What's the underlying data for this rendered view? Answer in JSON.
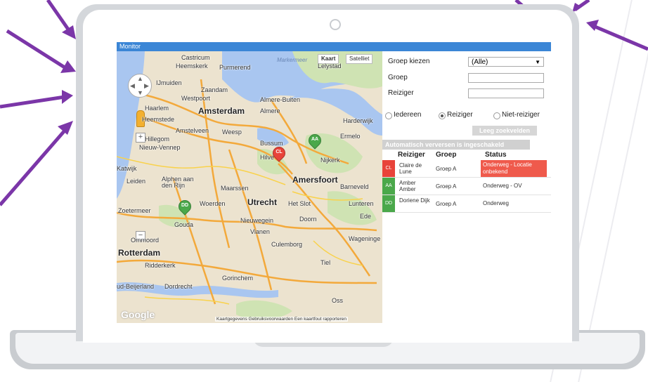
{
  "window_title": "Monitor",
  "map": {
    "type_buttons": [
      "Kaart",
      "Satelliet"
    ],
    "places": {
      "castricum": "Castricum",
      "heemskerk": "Heemskerk",
      "purmerend": "Purmerend",
      "markermeer": "Markermeer",
      "lelystad": "Lelystad",
      "ijmuiden": "IJmuiden",
      "zaandam": "Zaandam",
      "westpoort": "Westpoort",
      "almere_buiten": "Almere-Buiten",
      "haarlem": "Haarlem",
      "amsterdam": "Amsterdam",
      "almere": "Almere",
      "heemstede": "Heemstede",
      "harderwijk": "Harderwijk",
      "amstelveen": "Amstelveen",
      "weesp": "Weesp",
      "hillegom": "Hillegom",
      "ermelo": "Ermelo",
      "nieuw_vennep": "Nieuw-Vennep",
      "bussum": "Bussum",
      "hilversum": "Hilve",
      "nijkerk": "Nijkerk",
      "katwijk": "Katwijk",
      "leiden": "Leiden",
      "alphen": "Alphen aan\nden Rijn",
      "maarssen": "Maarssen",
      "amersfoort": "Amersfoort",
      "barneveld": "Barneveld",
      "woerden": "Woerden",
      "utrecht": "Utrecht",
      "hetslot": "Het Slot",
      "lunteren": "Lunteren",
      "zoetermeer": "Zoetermeer",
      "gouda": "Gouda",
      "nieuwegein": "Nieuwegein",
      "doorn": "Doorn",
      "ede": "Ede",
      "vianen": "Vianen",
      "ommoord": "Ommoord",
      "culemborg": "Culemborg",
      "wageningen": "Wageninge",
      "rotterdam": "Rotterdam",
      "tiel": "Tiel",
      "ridderkerk": "Ridderkerk",
      "gorinchem": "Gorinchem",
      "beijerland": "ud-Beijerland",
      "dordrecht": "Dordrecht",
      "oss": "Oss"
    },
    "footer": "Kaartgegevens   Gebruiksvoorwaarden   Een kaartfout rapporteren",
    "google": "Google",
    "pins": [
      {
        "label": "CL",
        "color": "#e8433a"
      },
      {
        "label": "AA",
        "color": "#4aa84a"
      },
      {
        "label": "DD",
        "color": "#4aa84a"
      }
    ]
  },
  "panel": {
    "group_select_label": "Groep kiezen",
    "group_select_value": "(Alle)",
    "group_label": "Groep",
    "traveler_label": "Reiziger",
    "radios": [
      "Iedereen",
      "Reiziger",
      "Niet-reiziger"
    ],
    "radio_selected": "Reiziger",
    "clear_button": "Leeg zoekvelden",
    "auto_refresh": "Automatisch verversen is ingeschakeld",
    "columns": [
      "Reiziger",
      "Groep",
      "Status"
    ],
    "rows": [
      {
        "badge": "CL",
        "badge_color": "#e8433a",
        "name": "Claire de Lune",
        "group": "Groep A",
        "status": "Onderweg - Locatie onbekend",
        "status_bg": "#ef5a4c",
        "status_color": "#ffffff"
      },
      {
        "badge": "AA",
        "badge_color": "#4aa84a",
        "name": "Amber Amber",
        "group": "Groep A",
        "status": "Onderweg - OV",
        "status_bg": "#ffffff",
        "status_color": "#333333"
      },
      {
        "badge": "DD",
        "badge_color": "#4aa84a",
        "name": "Doriene Dijk",
        "group": "Groep A",
        "status": "Onderweg",
        "status_bg": "#ffffff",
        "status_color": "#333333"
      }
    ]
  },
  "colors": {
    "titlebar": "#3b86d6",
    "arrow": "#7b36a8"
  }
}
